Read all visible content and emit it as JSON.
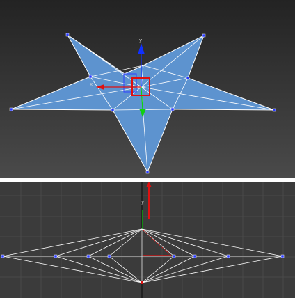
{
  "viewports": {
    "top": {
      "gizmo_labels": {
        "x": "x",
        "y": "y"
      }
    },
    "bottom": {
      "gizmo_labels": {
        "y": "y"
      }
    }
  },
  "colors": {
    "star_fill": "#5d93cf",
    "edge": "#ffffff",
    "vertex": "#2a3cff",
    "gizmo_x": "#e01010",
    "gizmo_y": "#10d010",
    "gizmo_z": "#1030ff",
    "selection_box": "#e01010",
    "grid": "#4a4a4a",
    "separator": "#ffffff"
  }
}
